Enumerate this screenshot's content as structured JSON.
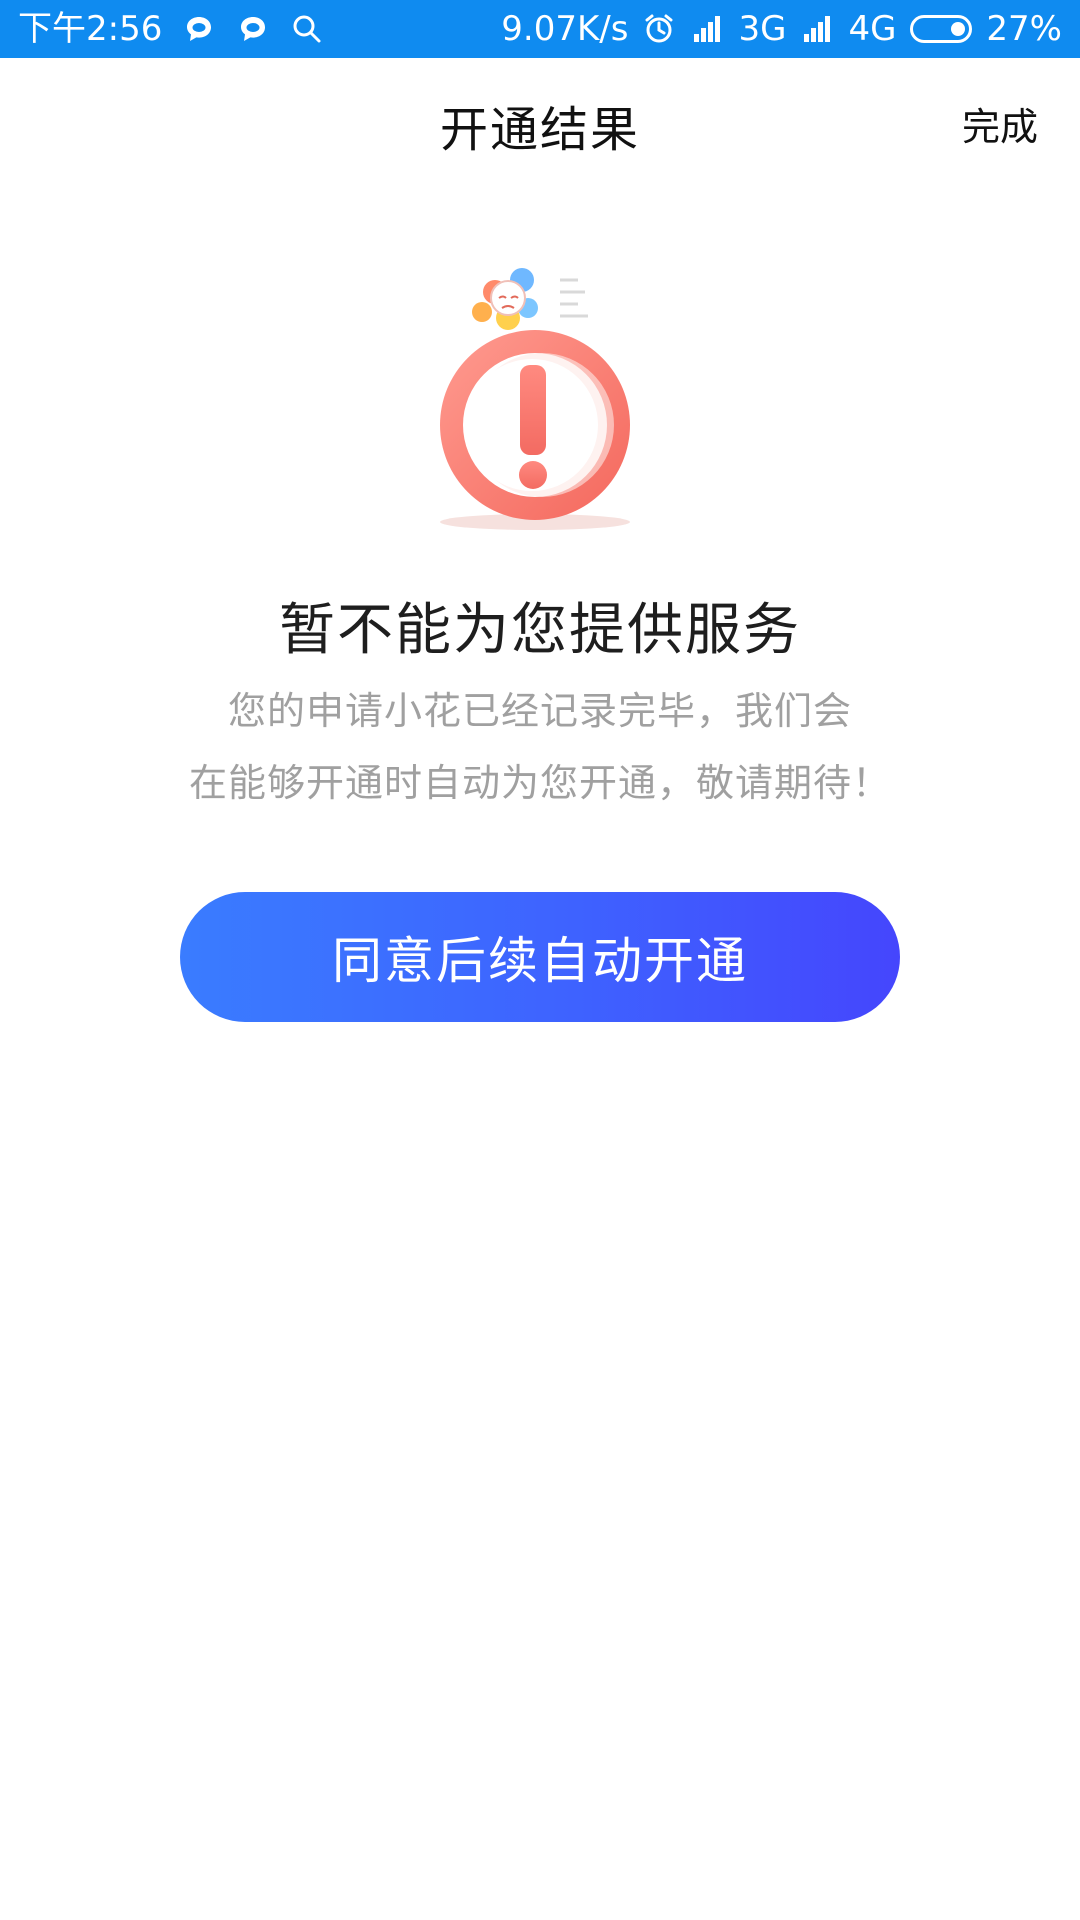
{
  "status_bar": {
    "time": "下午2:56",
    "net_speed": "9.07K/s",
    "sim1": "3G",
    "sim2": "4G",
    "battery": "27%",
    "icons": [
      "chat-bubble-icon",
      "chat-bubble-icon",
      "search-icon",
      "alarm-icon",
      "signal-icon",
      "signal-icon",
      "battery-icon"
    ],
    "background_color": "#0f8bf0"
  },
  "nav": {
    "title": "开通结果",
    "done_label": "完成"
  },
  "result": {
    "illustration_icon": "warning-exclamation-illustration",
    "headline": "暂不能为您提供服务",
    "desc_line1": "您的申请小花已经记录完毕，我们会",
    "desc_line2": "在能够开通时自动为您开通，敬请期待！"
  },
  "action": {
    "button_label": "同意后续自动开通",
    "gradient_start": "#3a7cff",
    "gradient_end": "#4546fd"
  }
}
